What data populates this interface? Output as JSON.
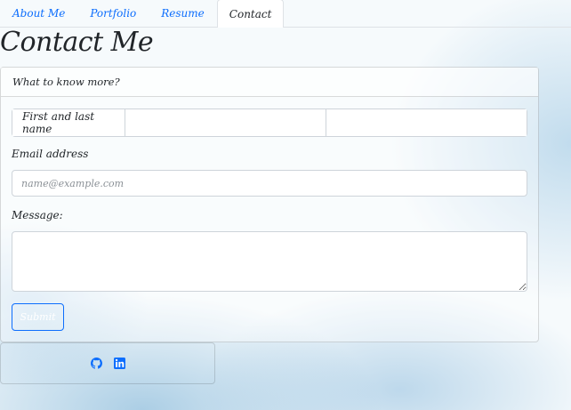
{
  "nav": {
    "tabs": [
      {
        "label": "About Me",
        "active": false
      },
      {
        "label": "Portfolio",
        "active": false
      },
      {
        "label": "Resume",
        "active": false
      },
      {
        "label": "Contact",
        "active": true
      }
    ]
  },
  "page": {
    "title": "Contact Me"
  },
  "form": {
    "header": "What to know more?",
    "name_label": "First and last name",
    "first_name_value": "",
    "last_name_value": "",
    "email_label": "Email address",
    "email_placeholder": "name@example.com",
    "message_label": "Message:",
    "message_value": "",
    "submit_label": "Submit"
  },
  "footer": {
    "icons": [
      "github-icon",
      "linkedin-icon"
    ]
  },
  "colors": {
    "link": "#0d6efd",
    "border": "#dee2e6"
  }
}
